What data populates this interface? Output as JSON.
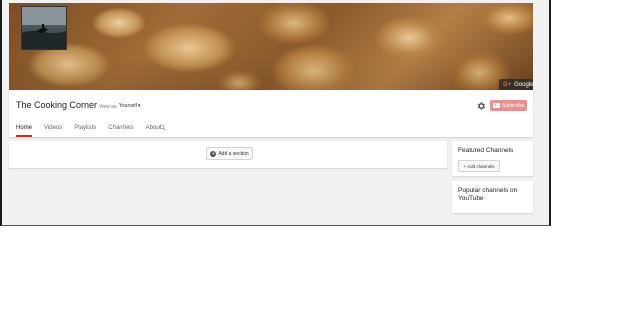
{
  "channel": {
    "title": "The Cooking Corner",
    "view_as_label": "View as:",
    "view_as_value": "Yourself"
  },
  "banner": {
    "gplus_icon": "G+",
    "gplus_label": "Google+"
  },
  "header": {
    "subscribe_label": "Subscribe"
  },
  "tabs": [
    {
      "label": "Home",
      "active": true
    },
    {
      "label": "Videos"
    },
    {
      "label": "Playlists"
    },
    {
      "label": "Channels"
    },
    {
      "label": "About"
    }
  ],
  "main": {
    "add_section_label": "Add a section"
  },
  "sidebar": {
    "featured_title": "Featured Channels",
    "add_channels_label": "+ Add channels",
    "popular_title": "Popular channels on YouTube"
  },
  "colors": {
    "subscribe_bg": "#e8908c",
    "active_tab_underline": "#cc2a22",
    "page_bg": "#f1f1f1"
  },
  "icons": [
    "settings-gear-icon",
    "search-icon",
    "youtube-play-icon",
    "plus-circle-icon",
    "google-plus-icon",
    "caret-down-icon"
  ]
}
